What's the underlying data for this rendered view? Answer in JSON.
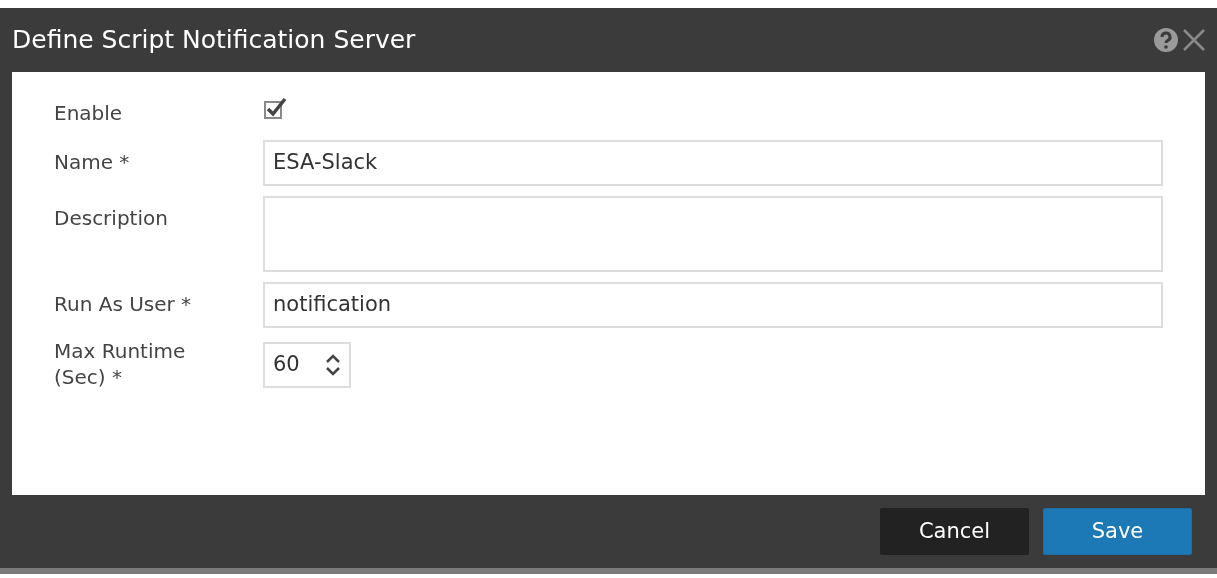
{
  "window": {
    "title": "Define Script Notification Server"
  },
  "fields": [
    {
      "kind": "checkbox",
      "label": "Enable",
      "checked": true
    },
    {
      "kind": "text",
      "label": "Name *",
      "value": "ESA-Slack"
    },
    {
      "kind": "textarea",
      "label": "Description"
    },
    {
      "kind": "text",
      "label": "Run As User *",
      "value": "notification"
    },
    {
      "kind": "spinner",
      "label": "Max Runtime (Sec) *",
      "value": "60"
    }
  ],
  "buttons": [
    {
      "kind": "secondary",
      "label": "Cancel"
    },
    {
      "kind": "primary",
      "label": "Save"
    }
  ]
}
